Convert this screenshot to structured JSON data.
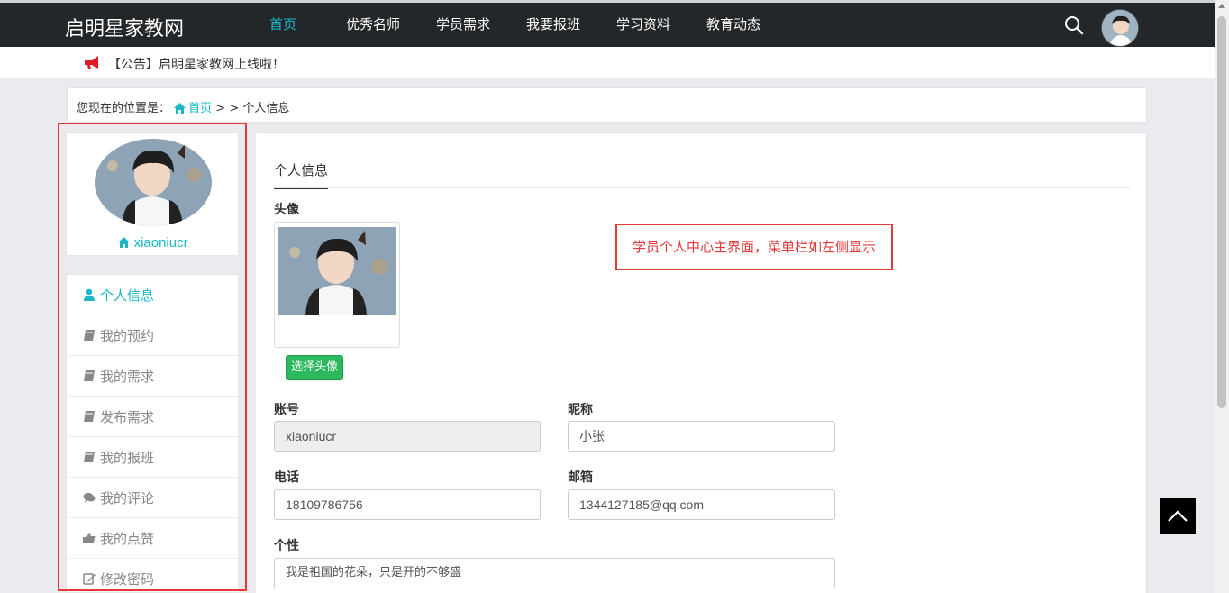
{
  "brand": "启明星家教网",
  "nav": [
    {
      "label": "首页",
      "active": true
    },
    {
      "label": "优秀名师",
      "active": false
    },
    {
      "label": "学员需求",
      "active": false
    },
    {
      "label": "我要报班",
      "active": false
    },
    {
      "label": "学习资料",
      "active": false
    },
    {
      "label": "教育动态",
      "active": false
    }
  ],
  "notice": "【公告】启明星家教网上线啦！",
  "breadcrumb": {
    "prefix": "您现在的位置是：",
    "home": "首页",
    "sep": " > > ",
    "current": "个人信息"
  },
  "profile": {
    "username": "xiaoniucr"
  },
  "menu": [
    {
      "label": "个人信息",
      "icon": "user-icon",
      "active": true
    },
    {
      "label": "我的预约",
      "icon": "book-icon",
      "active": false
    },
    {
      "label": "我的需求",
      "icon": "book-icon",
      "active": false
    },
    {
      "label": "发布需求",
      "icon": "book-icon",
      "active": false
    },
    {
      "label": "我的报班",
      "icon": "book-icon",
      "active": false
    },
    {
      "label": "我的评论",
      "icon": "comments-icon",
      "active": false
    },
    {
      "label": "我的点赞",
      "icon": "thumbs-up-icon",
      "active": false
    },
    {
      "label": "修改密码",
      "icon": "edit-icon",
      "active": false
    }
  ],
  "main": {
    "tab": "个人信息",
    "avatar_label": "头像",
    "choose_avatar": "选择头像",
    "note": "学员个人中心主界面，菜单栏如左侧显示",
    "fields": {
      "account_label": "账号",
      "account": "xiaoniucr",
      "nickname_label": "昵称",
      "nickname": "小张",
      "phone_label": "电话",
      "phone": "18109786756",
      "email_label": "邮箱",
      "email": "1344127185@qq.com",
      "bio_label": "个性",
      "bio": "我是祖国的花朵，只是开的不够盛"
    }
  },
  "colors": {
    "accent": "#1cb8c8",
    "nav_bg": "#242729",
    "highlight": "#e23a3a",
    "button_green": "#2cb85c"
  }
}
